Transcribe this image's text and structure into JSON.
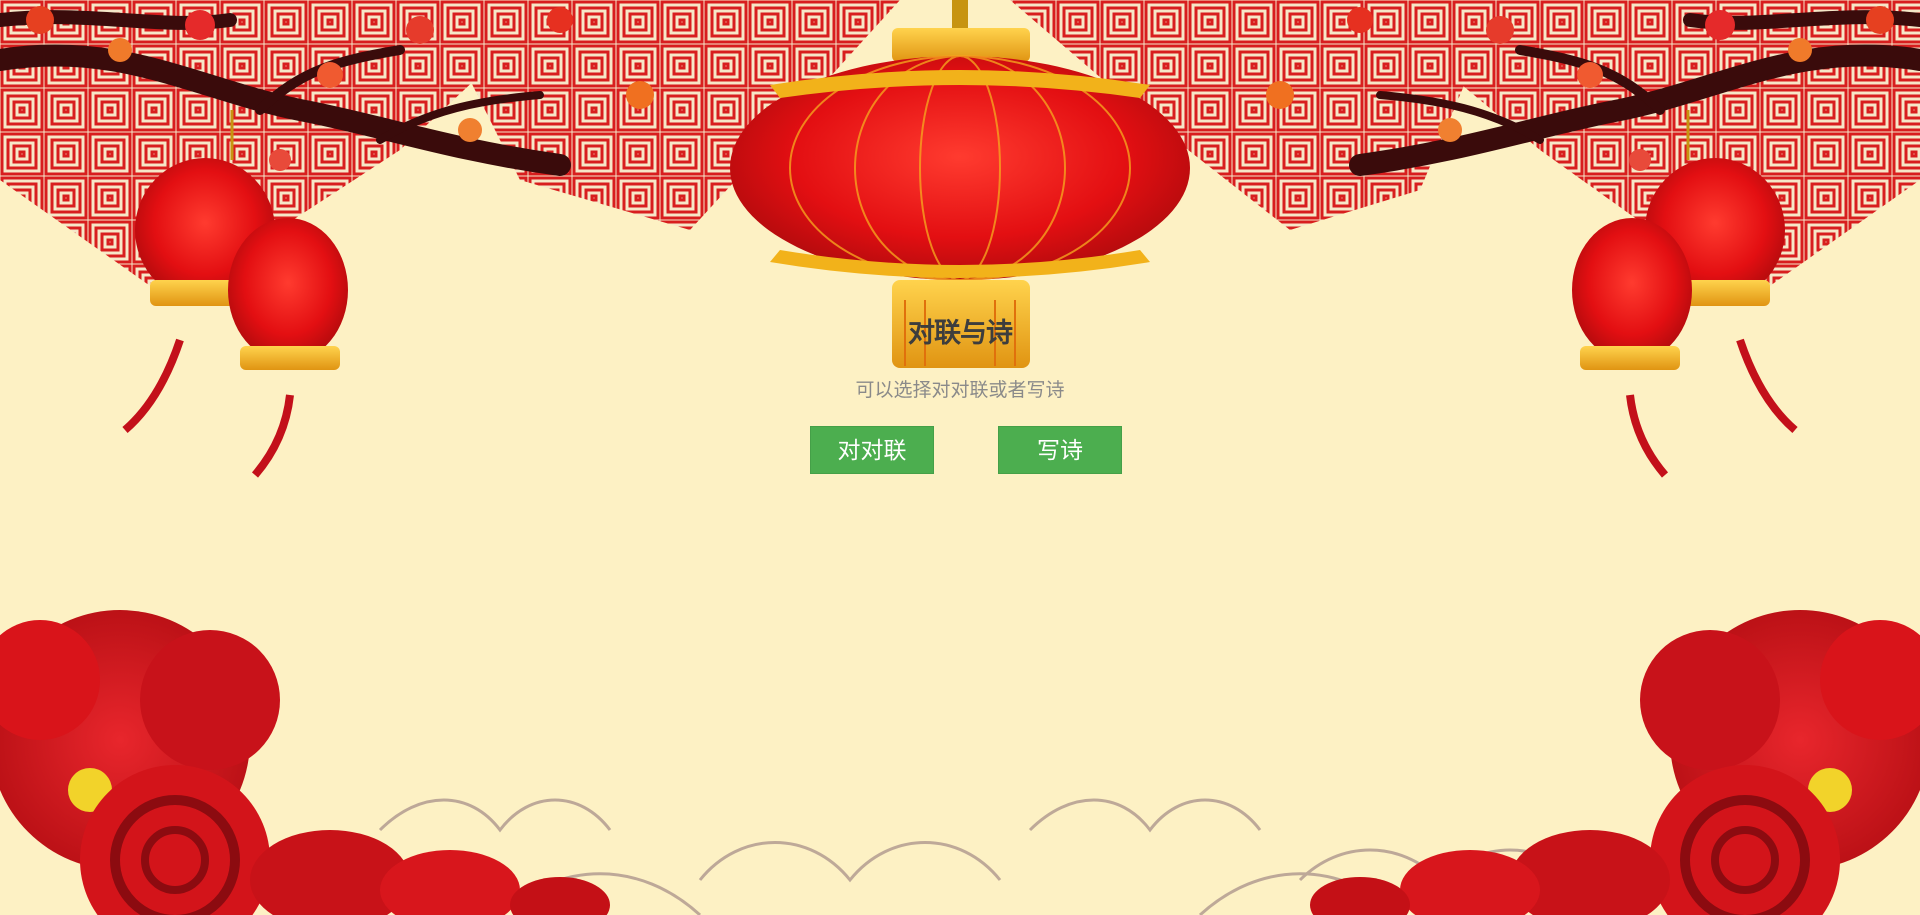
{
  "page": {
    "title": "对联与诗",
    "subtitle": "可以选择对对联或者写诗"
  },
  "actions": {
    "couplet_label": "对对联",
    "poem_label": "写诗"
  },
  "colors": {
    "background": "#fdf1c4",
    "button": "#4cae4f",
    "lantern_red": "#e30f12",
    "lantern_gold": "#f2b21a",
    "pattern_red": "#d81e1e"
  },
  "decorations": [
    "red-lattice-pattern",
    "plum-blossom-branch",
    "large-red-lantern",
    "small-red-lanterns",
    "red-peony-flowers",
    "auspicious-clouds",
    "wave-line-pattern"
  ]
}
